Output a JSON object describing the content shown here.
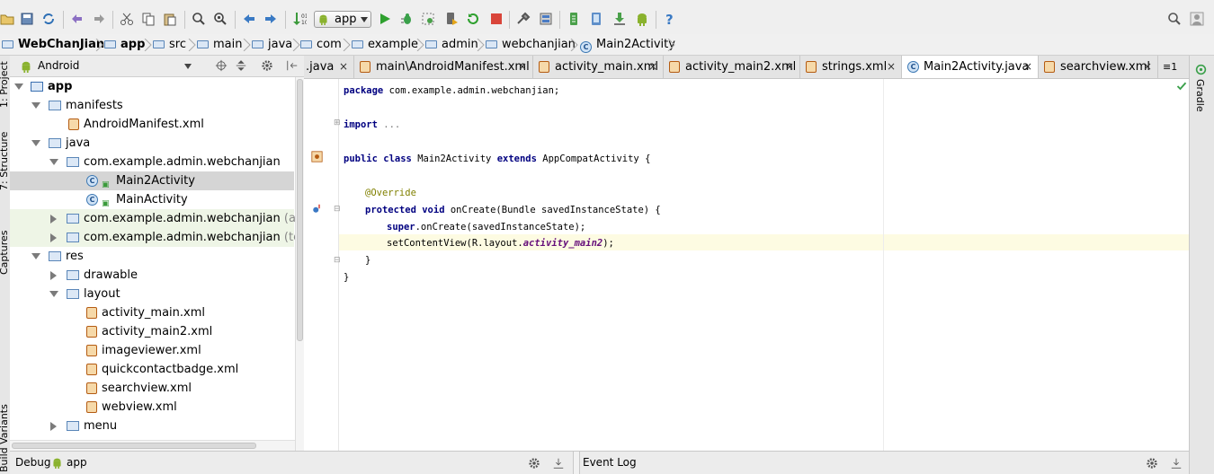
{
  "toolbar": {
    "run_config": "app",
    "icons": [
      "open-icon",
      "save-icon",
      "sync-icon",
      "undo-icon",
      "redo-icon",
      "cut-icon",
      "copy-icon",
      "paste-icon",
      "find-icon",
      "replace-icon",
      "back-icon",
      "forward-icon",
      "make-icon",
      "run-icon",
      "debug-icon",
      "attach-icon",
      "apply-changes-icon",
      "rerun-icon",
      "stop-icon",
      "project-structure-icon",
      "sdk-manager-icon",
      "avd-manager-icon",
      "gradle-sync-icon",
      "android-monitor-icon",
      "help-icon",
      "search-everywhere-icon",
      "settings-icon"
    ]
  },
  "breadcrumb": [
    {
      "label": "WebChanJian",
      "bold": true
    },
    {
      "label": "app",
      "bold": true
    },
    {
      "label": "src"
    },
    {
      "label": "main"
    },
    {
      "label": "java"
    },
    {
      "label": "com"
    },
    {
      "label": "example"
    },
    {
      "label": "admin"
    },
    {
      "label": "webchanjian"
    },
    {
      "label": "Main2Activity",
      "class": true
    }
  ],
  "project_panel": {
    "view_mode": "Android",
    "tree": [
      {
        "label": "app",
        "depth": 0,
        "icon": "module",
        "expanded": true,
        "bold": true
      },
      {
        "label": "manifests",
        "depth": 1,
        "icon": "folder",
        "expanded": true
      },
      {
        "label": "AndroidManifest.xml",
        "depth": 2,
        "icon": "xml"
      },
      {
        "label": "java",
        "depth": 1,
        "icon": "folder",
        "expanded": true
      },
      {
        "label": "com.example.admin.webchanjian",
        "depth": 2,
        "icon": "package",
        "expanded": true
      },
      {
        "label": "Main2Activity",
        "depth": 3,
        "icon": "class",
        "selected": true
      },
      {
        "label": "MainActivity",
        "depth": 3,
        "icon": "class"
      },
      {
        "label": "com.example.admin.webchanjian",
        "suffix": "(andro",
        "depth": 2,
        "icon": "package",
        "collapsed": true,
        "hl": true
      },
      {
        "label": "com.example.admin.webchanjian",
        "suffix": "(test)",
        "depth": 2,
        "icon": "package",
        "collapsed": true,
        "hl": true
      },
      {
        "label": "res",
        "depth": 1,
        "icon": "folder",
        "expanded": true
      },
      {
        "label": "drawable",
        "depth": 2,
        "icon": "folder",
        "collapsed": true
      },
      {
        "label": "layout",
        "depth": 2,
        "icon": "folder",
        "expanded": true
      },
      {
        "label": "activity_main.xml",
        "depth": 3,
        "icon": "xml"
      },
      {
        "label": "activity_main2.xml",
        "depth": 3,
        "icon": "xml"
      },
      {
        "label": "imageviewer.xml",
        "depth": 3,
        "icon": "xml"
      },
      {
        "label": "quickcontactbadge.xml",
        "depth": 3,
        "icon": "xml"
      },
      {
        "label": "searchview.xml",
        "depth": 3,
        "icon": "xml"
      },
      {
        "label": "webview.xml",
        "depth": 3,
        "icon": "xml"
      },
      {
        "label": "menu",
        "depth": 2,
        "icon": "folder",
        "collapsed": true
      }
    ]
  },
  "side_tabs_left": [
    "1: Project",
    "7: Structure",
    "Captures",
    "Build Variants"
  ],
  "side_tabs_right": [
    "Gradle"
  ],
  "editor_tabs": [
    {
      "label": ".java",
      "partial": true
    },
    {
      "label": "main\\AndroidManifest.xml",
      "icon": "xml"
    },
    {
      "label": "activity_main.xml",
      "icon": "xml"
    },
    {
      "label": "activity_main2.xml",
      "icon": "xml"
    },
    {
      "label": "strings.xml",
      "icon": "xml"
    },
    {
      "label": "Main2Activity.java",
      "icon": "class",
      "active": true
    },
    {
      "label": "searchview.xml",
      "icon": "xml"
    }
  ],
  "tab_close_glyph": "×",
  "tab_overflow": "≡1",
  "code": {
    "line1": "package com.example.admin.webchanjian;",
    "imp_kw": "import",
    "imp_rest": " ...",
    "c_public": "public",
    "c_class": "class",
    "c_name": " Main2Activity ",
    "c_extends": "extends",
    "c_super": " AppCompatActivity {",
    "override": "@Override",
    "m_protected": "protected",
    "m_void": "void",
    "m_rest": " onCreate(Bundle savedInstanceState) {",
    "s_super": "super",
    "s_rest": ".onCreate(savedInstanceState);",
    "set_a": "setContentView(R.layout.",
    "set_b": "activity_main2",
    "set_c": ");",
    "close1": "}",
    "close2": "}"
  },
  "bottom": {
    "debug_label": "Debug",
    "debug_config": "app",
    "event_log": "Event Log"
  }
}
